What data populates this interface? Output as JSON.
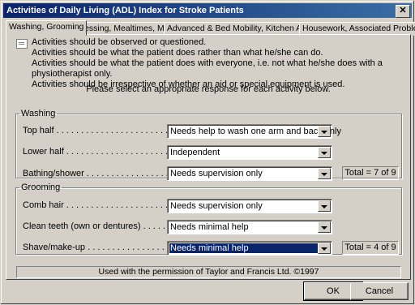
{
  "window": {
    "title": "Activities of Daily Living (ADL) Index for Stroke Patients",
    "close_label": "✕"
  },
  "tabs": [
    {
      "label": "Washing, Grooming"
    },
    {
      "label": "Dressing, Mealtimes, Mobility"
    },
    {
      "label": "Advanced & Bed Mobility, Kitchen Activities"
    },
    {
      "label": "Housework, Associated Problems"
    }
  ],
  "info_lines": [
    "Activities should be observed or questioned.",
    "Activities should be what the patient does rather than what he/she can do.",
    "Activities should be what the patient does with everyone, i.e. not what he/she does with a physiotherapist only.",
    "Activities should be irrespective of whether an aid or special equipment is used."
  ],
  "prompt": "Please select an appropriate response for each activity below.",
  "washing": {
    "legend": "Washing",
    "rows": [
      {
        "label": "Top half . . . . . . . . . . . . . . . . . . . . . . . . . . . . . . .",
        "value": "Needs help to wash one arm and back only"
      },
      {
        "label": "Lower half . . . . . . . . . . . . . . . . . . . . . . . . . . . . .",
        "value": "Independent"
      },
      {
        "label": "Bathing/shower . . . . . . . . . . . . . . . . . . . . . . . . .",
        "value": "Needs supervision only"
      }
    ],
    "total": "Total = 7 of 9"
  },
  "grooming": {
    "legend": "Grooming",
    "rows": [
      {
        "label": "Comb hair . . . . . . . . . . . . . . . . . . . . . . . . . . . . .",
        "value": "Needs supervision only"
      },
      {
        "label": "Clean teeth (own or dentures) . . . . . . . . . . .",
        "value": "Needs minimal help"
      },
      {
        "label": "Shave/make-up . . . . . . . . . . . . . . . . . . . . . . . . .",
        "value": "Needs minimal help"
      }
    ],
    "total": "Total = 4 of 9"
  },
  "footer": "Used with the permission of Taylor and Francis Ltd.  ©1997",
  "buttons": {
    "ok": "OK",
    "cancel": "Cancel"
  }
}
